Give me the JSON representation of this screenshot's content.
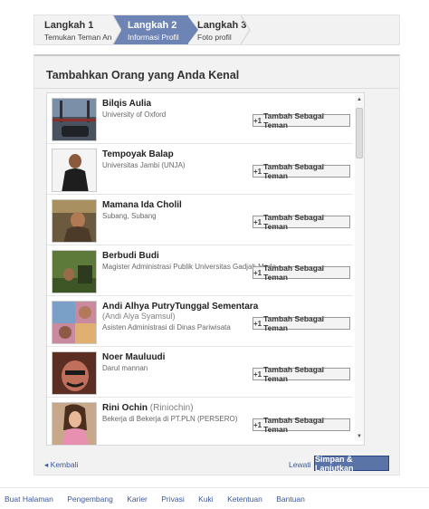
{
  "steps": [
    {
      "title": "Langkah 1",
      "sub": "Temukan Teman Anda"
    },
    {
      "title": "Langkah 2",
      "sub": "Informasi Profil"
    },
    {
      "title": "Langkah 3",
      "sub": "Foto profil"
    }
  ],
  "panel": {
    "title": "Tambahkan Orang yang Anda Kenal",
    "add_label": "Tambah Sebagai Teman",
    "add_icon": "add-friend-icon"
  },
  "people": [
    {
      "name": "Bilqis Aulia",
      "alt": "",
      "lines": [
        "University of Oxford"
      ]
    },
    {
      "name": "Tempoyak Balap",
      "alt": "",
      "lines": [
        "Universitas Jambi (UNJA)"
      ]
    },
    {
      "name": "Mamana Ida Cholil",
      "alt": "",
      "lines": [
        "Subang, Subang"
      ]
    },
    {
      "name": "Berbudi Budi",
      "alt": "",
      "lines": [
        "Magister Administrasi Publik Universitas Gadjah Mada"
      ]
    },
    {
      "name": "Andi Alhya PutryTunggal Sementara",
      "alt": "",
      "lines": [
        "(Andi Alya Syamsul)",
        "Asisten Administrasi di Dinas Pariwisata"
      ]
    },
    {
      "name": "Noer Mauluudi",
      "alt": "",
      "lines": [
        "Darul mannan"
      ]
    },
    {
      "name": "Rini Ochin",
      "alt": "(Riniochin)",
      "lines": [
        "Bekerja di Bekerja di PT.PLN (PERSERO)"
      ]
    }
  ],
  "actions": {
    "back": "Kembali",
    "skip": "Lewati",
    "save": "Simpan & Lanjutkan"
  },
  "footer": [
    "Buat Halaman",
    "Pengembang",
    "Karier",
    "Privasi",
    "Kuki",
    "Ketentuan",
    "Bantuan"
  ],
  "colors": {
    "active_step": "#6d84b4",
    "link": "#3b5998",
    "primary_button": "#5b74a8"
  }
}
